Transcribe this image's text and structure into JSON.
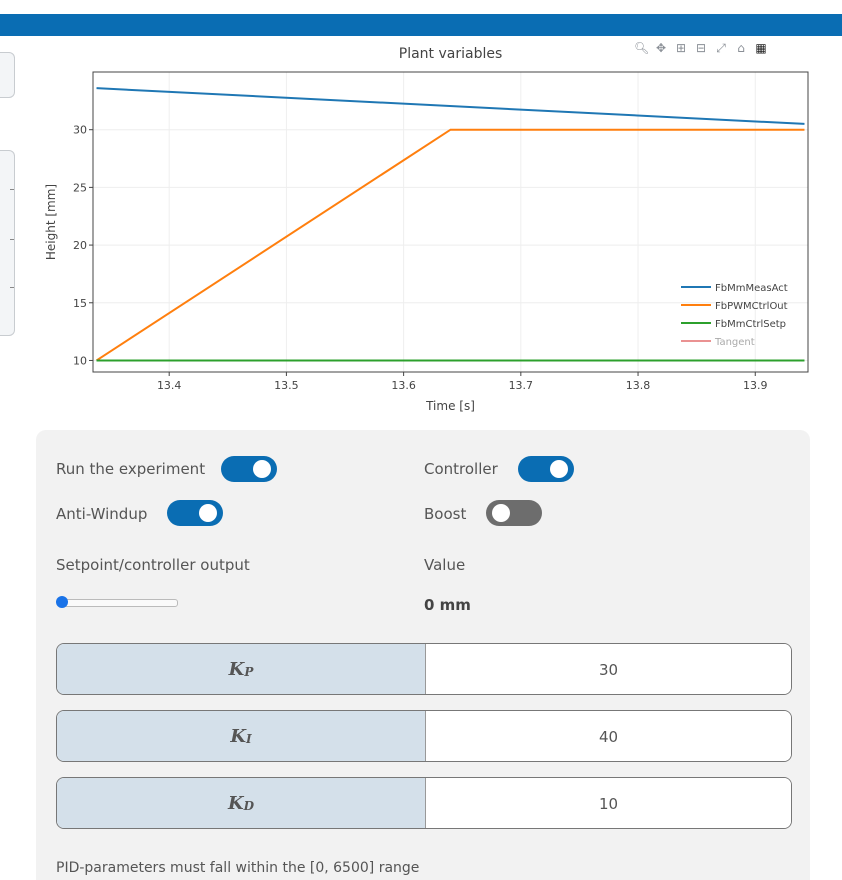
{
  "app": {
    "accent_color": "#0a6db3"
  },
  "chart_data": {
    "type": "line",
    "title": "Plant variables",
    "xlabel": "Time [s]",
    "ylabel": "Height [mm]",
    "xlim": [
      13.335,
      13.945
    ],
    "ylim": [
      9.0,
      35.0
    ],
    "x_ticks": [
      13.4,
      13.5,
      13.6,
      13.7,
      13.8,
      13.9
    ],
    "y_ticks": [
      10,
      15,
      20,
      25,
      30
    ],
    "grid": true,
    "legend_position": "bottom-right",
    "series": [
      {
        "name": "FbMmMeasAct",
        "color": "#1f77b4",
        "x": [
          13.338,
          13.942
        ],
        "y": [
          33.6,
          30.5
        ]
      },
      {
        "name": "FbPWMCtrlOut",
        "color": "#ff7f0e",
        "x": [
          13.338,
          13.64,
          13.942
        ],
        "y": [
          10,
          30,
          30
        ]
      },
      {
        "name": "FbMmCtrlSetp",
        "color": "#2ca02c",
        "x": [
          13.338,
          13.942
        ],
        "y": [
          10,
          10
        ]
      },
      {
        "name": "Tangent",
        "color": "#d62728",
        "x": [],
        "y": []
      }
    ]
  },
  "modebar": {
    "icons": [
      "zoom-icon",
      "pan-icon",
      "zoom-in-icon",
      "zoom-out-icon",
      "autoscale-icon",
      "reset-axes-icon",
      "plotly-logo-icon"
    ]
  },
  "controls": {
    "run_label": "Run the experiment",
    "run_on": true,
    "controller_label": "Controller",
    "controller_on": true,
    "antiwindup_label": "Anti-Windup",
    "antiwindup_on": true,
    "boost_label": "Boost",
    "boost_on": false,
    "setpoint_label": "Setpoint/controller output",
    "setpoint_fraction": 0.0,
    "value_label": "Value",
    "value_text": "0 mm"
  },
  "params": {
    "kp": {
      "symbol": "K",
      "sub": "P",
      "value": "30"
    },
    "ki": {
      "symbol": "K",
      "sub": "I",
      "value": "40"
    },
    "kd": {
      "symbol": "K",
      "sub": "D",
      "value": "10"
    }
  },
  "note": "PID-parameters must fall within the [0, 6500] range"
}
